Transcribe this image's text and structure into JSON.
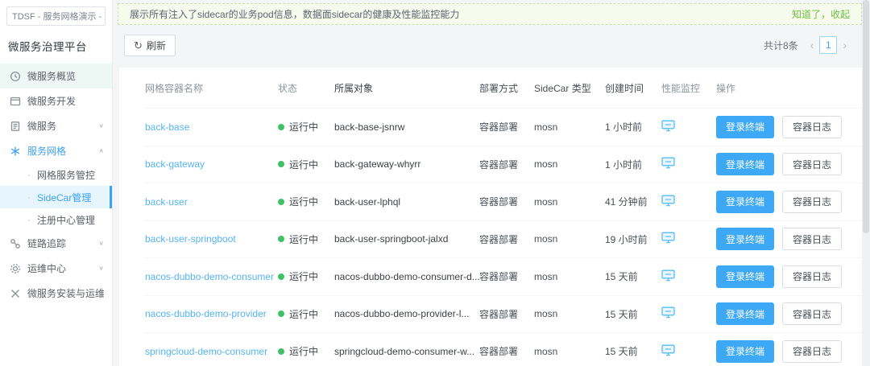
{
  "tenant": {
    "label": "TDSF - 服务网格演示 - 默..."
  },
  "platform_title": "微服务治理平台",
  "icons": {
    "chevron_down": "∨",
    "chevron_up": "∧",
    "refresh": "↻",
    "prev": "‹",
    "next": "›",
    "bullet": "·"
  },
  "sidebar": {
    "items": [
      {
        "label": "微服务概览"
      },
      {
        "label": "微服务开发"
      },
      {
        "label": "微服务"
      },
      {
        "label": "服务网格"
      },
      {
        "label": "网格服务管控"
      },
      {
        "label": "SideCar管理"
      },
      {
        "label": "注册中心管理"
      },
      {
        "label": "链路追踪"
      },
      {
        "label": "运维中心"
      },
      {
        "label": "微服务安装与运维"
      }
    ]
  },
  "banner": {
    "message": "展示所有注入了sidecar的业务pod信息，数据面sidecar的健康及性能监控能力",
    "dismiss": "知道了，收起"
  },
  "toolbar": {
    "refresh_label": "刷新"
  },
  "pagination": {
    "total": "共计8条",
    "page": "1"
  },
  "table": {
    "headers": [
      "网格容器名称",
      "状态",
      "所属对象",
      "部署方式",
      "SideCar 类型",
      "创建时间",
      "性能监控",
      "操作"
    ],
    "actions": {
      "login": "登录终端",
      "logs": "容器日志"
    },
    "rows": [
      {
        "name": "back-base",
        "status": "运行中",
        "object": "back-base-jsnrw",
        "deploy": "容器部署",
        "sidecar": "mosn",
        "created": "1 小时前"
      },
      {
        "name": "back-gateway",
        "status": "运行中",
        "object": "back-gateway-whyrr",
        "deploy": "容器部署",
        "sidecar": "mosn",
        "created": "1 小时前"
      },
      {
        "name": "back-user",
        "status": "运行中",
        "object": "back-user-lphql",
        "deploy": "容器部署",
        "sidecar": "mosn",
        "created": "41 分钟前"
      },
      {
        "name": "back-user-springboot",
        "status": "运行中",
        "object": "back-user-springboot-jalxd",
        "deploy": "容器部署",
        "sidecar": "mosn",
        "created": "19 小时前"
      },
      {
        "name": "nacos-dubbo-demo-consumer",
        "status": "运行中",
        "object": "nacos-dubbo-demo-consumer-d...",
        "deploy": "容器部署",
        "sidecar": "mosn",
        "created": "15 天前"
      },
      {
        "name": "nacos-dubbo-demo-provider",
        "status": "运行中",
        "object": "nacos-dubbo-demo-provider-l...",
        "deploy": "容器部署",
        "sidecar": "mosn",
        "created": "15 天前"
      },
      {
        "name": "springcloud-demo-consumer",
        "status": "运行中",
        "object": "springcloud-demo-consumer-w...",
        "deploy": "容器部署",
        "sidecar": "mosn",
        "created": "15 天前"
      }
    ]
  },
  "colors": {
    "accent_blue": "#3da8f5",
    "status_green": "#3fc267",
    "banner_green_bg": "#f6fbee",
    "banner_link_green": "#6cbf3f"
  }
}
